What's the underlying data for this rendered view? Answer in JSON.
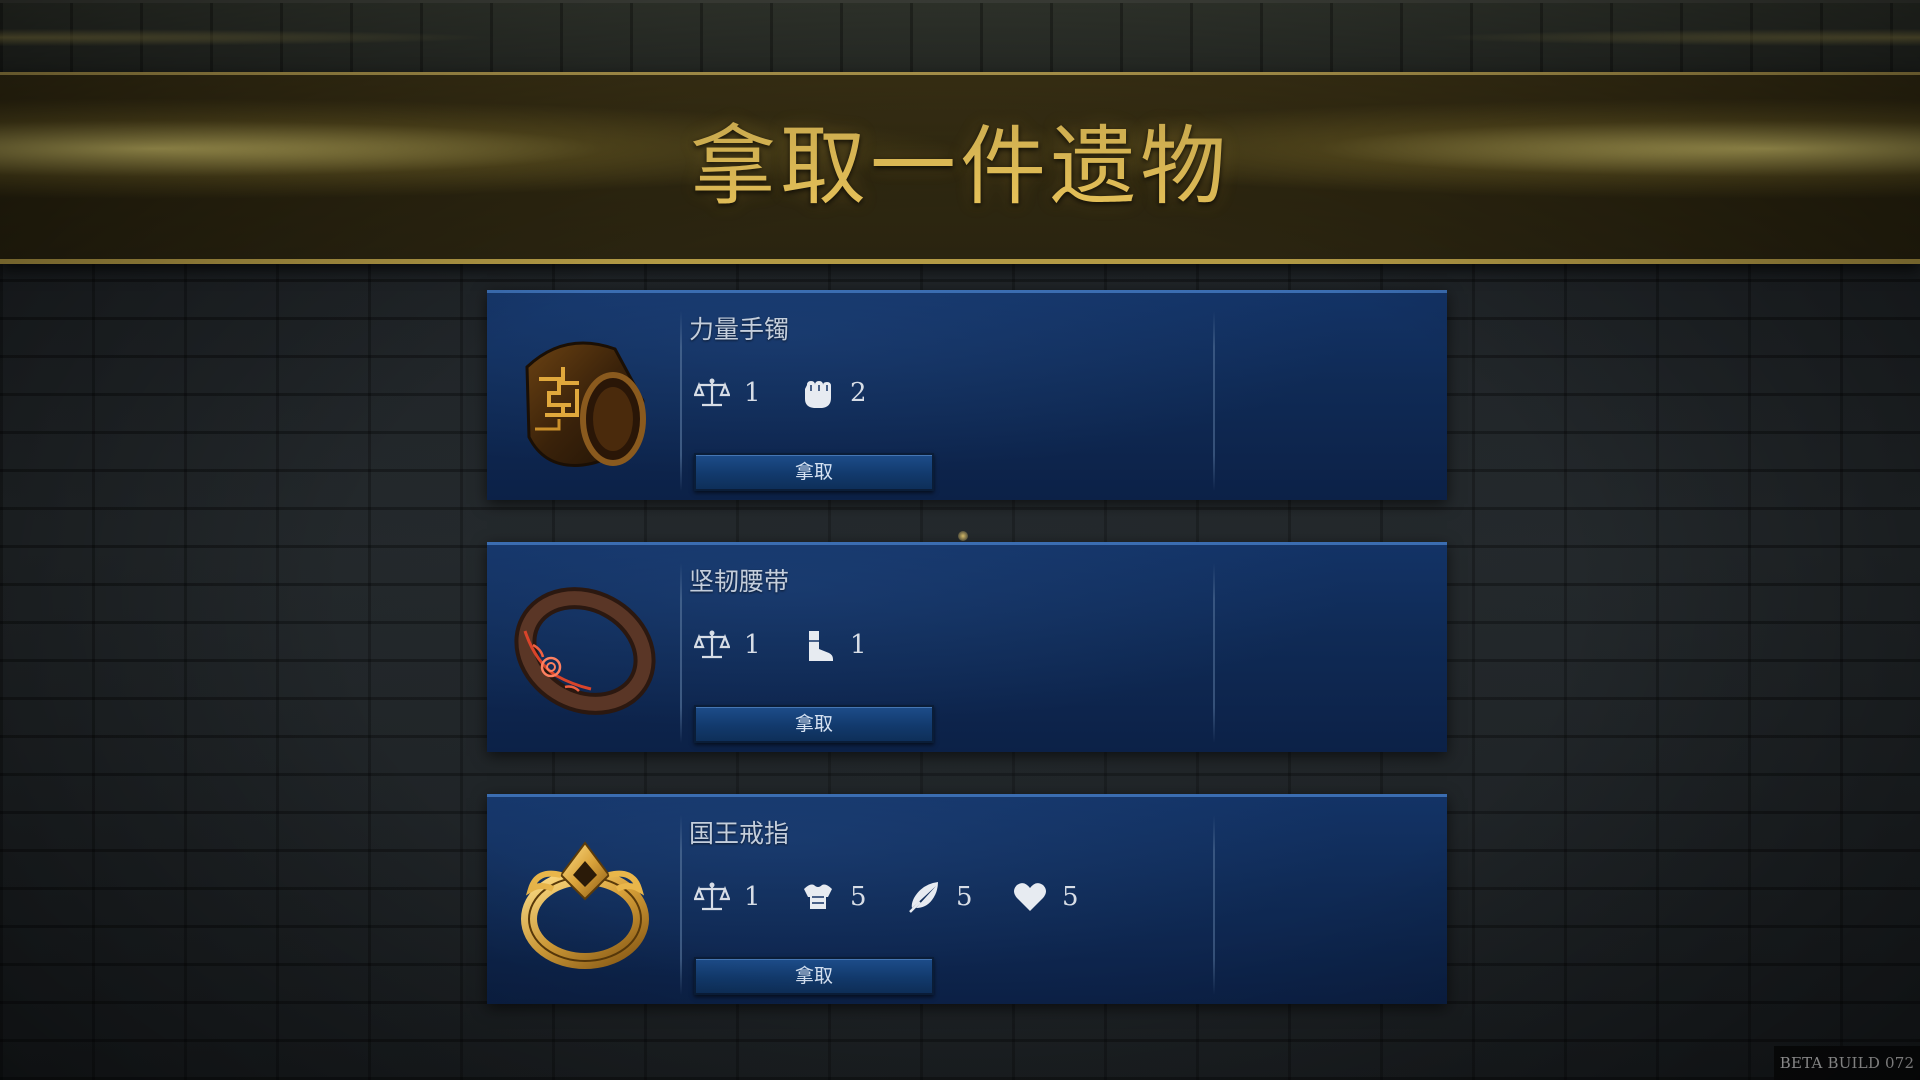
{
  "banner": {
    "title": "拿取一件遗物"
  },
  "relics": [
    {
      "name": "力量手镯",
      "art": "bracer-art",
      "stats": [
        {
          "icon": "scales-icon",
          "value": "1"
        },
        {
          "icon": "fist-icon",
          "value": "2"
        }
      ],
      "take_label": "拿取"
    },
    {
      "name": "坚韧腰带",
      "art": "belt-art",
      "stats": [
        {
          "icon": "scales-icon",
          "value": "1"
        },
        {
          "icon": "boot-icon",
          "value": "1"
        }
      ],
      "take_label": "拿取"
    },
    {
      "name": "国王戒指",
      "art": "ring-art",
      "stats": [
        {
          "icon": "scales-icon",
          "value": "1"
        },
        {
          "icon": "armor-icon",
          "value": "5"
        },
        {
          "icon": "feather-icon",
          "value": "5"
        },
        {
          "icon": "heart-icon",
          "value": "5"
        }
      ],
      "take_label": "拿取"
    }
  ],
  "build_label": "BETA BUILD 072",
  "colors": {
    "title_gold": "#e9c45a",
    "card_blue": "#133366",
    "button_blue": "#1d4d8a"
  }
}
